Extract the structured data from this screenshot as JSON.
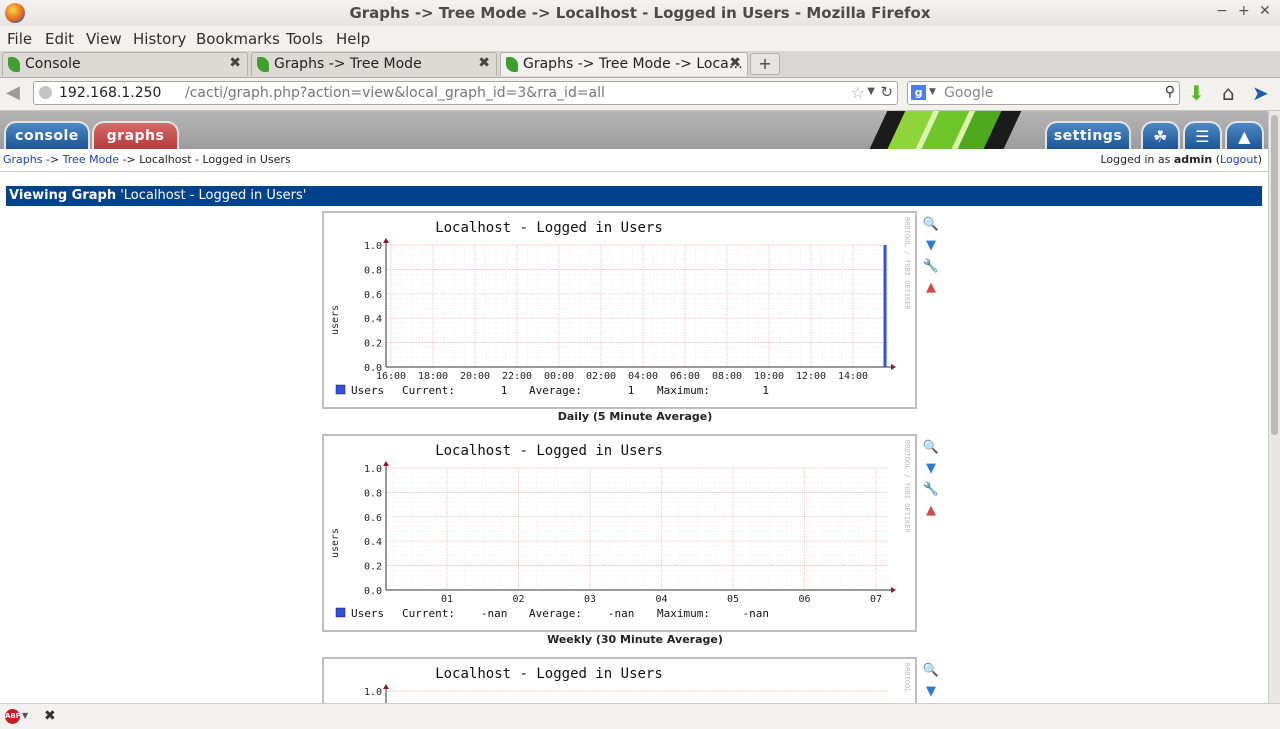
{
  "window": {
    "title": "Graphs -> Tree Mode -> Localhost - Logged in Users - Mozilla Firefox",
    "min": "−",
    "max": "+",
    "close": "✕"
  },
  "menu": [
    "File",
    "Edit",
    "View",
    "History",
    "Bookmarks",
    "Tools",
    "Help"
  ],
  "tabs": [
    {
      "label": "Console",
      "close": "✖"
    },
    {
      "label": "Graphs -> Tree Mode",
      "close": "✖"
    },
    {
      "label": "Graphs -> Tree Mode -> Loca…",
      "close": "✖"
    }
  ],
  "newtab": "+",
  "url": {
    "host": "192.168.1.250",
    "path": "/cacti/graph.php?action=view&local_graph_id=3&rra_id=all"
  },
  "search": {
    "engine": "g",
    "placeholder": "Google"
  },
  "cacti": {
    "tabs": {
      "console": "console",
      "graphs": "graphs",
      "settings": "settings"
    },
    "breadcrumb": {
      "graphs": "Graphs",
      "sep": "->",
      "tree": "Tree Mode",
      "current": "Localhost - Logged in Users"
    },
    "login": {
      "prefix": "Logged in as",
      "user": "admin",
      "logout": "Logout"
    },
    "view_label": "Viewing Graph",
    "view_name": "'Localhost - Logged in Users'"
  },
  "graphs": [
    {
      "title": "Localhost - Logged in Users",
      "caption": "Daily (5 Minute Average)",
      "ylabel": "users",
      "yticks": [
        "1.0",
        "0.8",
        "0.6",
        "0.4",
        "0.2",
        "0.0"
      ],
      "xticks": [
        "16:00",
        "18:00",
        "20:00",
        "22:00",
        "00:00",
        "02:00",
        "04:00",
        "06:00",
        "08:00",
        "10:00",
        "12:00",
        "14:00"
      ],
      "legend": {
        "series": "Users",
        "current_label": "Current:",
        "current": "1",
        "average_label": "Average:",
        "average": "1",
        "maximum_label": "Maximum:",
        "maximum": "1"
      },
      "watermark": "RRDTOOL / TOBI OETIKER"
    },
    {
      "title": "Localhost - Logged in Users",
      "caption": "Weekly (30 Minute Average)",
      "ylabel": "users",
      "yticks": [
        "1.0",
        "0.8",
        "0.6",
        "0.4",
        "0.2",
        "0.0"
      ],
      "xticks": [
        "01",
        "02",
        "03",
        "04",
        "05",
        "06",
        "07"
      ],
      "legend": {
        "series": "Users",
        "current_label": "Current:",
        "current": "-nan",
        "average_label": "Average:",
        "average": "-nan",
        "maximum_label": "Maximum:",
        "maximum": "-nan"
      },
      "watermark": "RRDTOOL / TOBI OETIKER"
    },
    {
      "title": "Localhost - Logged in Users",
      "yticks": [
        "1.0"
      ],
      "watermark": "RRDTOOL"
    }
  ],
  "colors": {
    "series": "#3050e0",
    "grid": "#f2b8b8",
    "header": "#00438c",
    "tab_blue": "#1d5596",
    "tab_red": "#b33a3a"
  }
}
